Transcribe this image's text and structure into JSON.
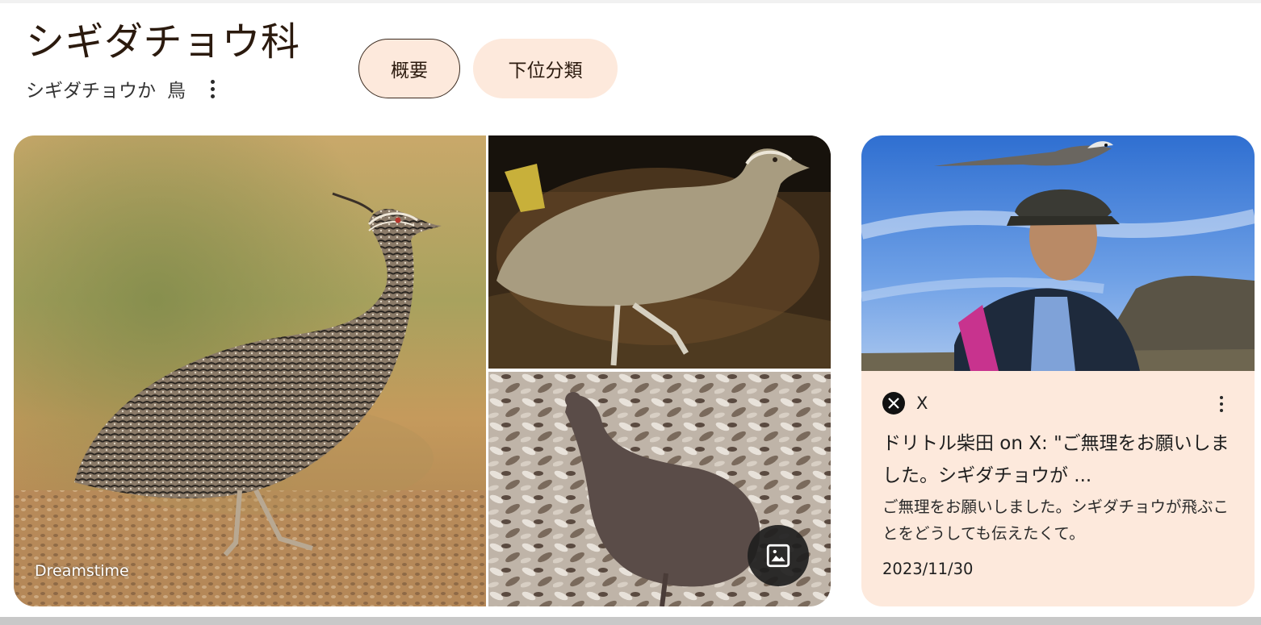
{
  "header": {
    "title": "シギダチョウ科",
    "subtitle_parts": [
      "シギダチョウか",
      "鳥"
    ],
    "more_icon": "more-vert-icon"
  },
  "chips": [
    {
      "label": "概要",
      "selected": true
    },
    {
      "label": "下位分類",
      "selected": false
    }
  ],
  "images": {
    "main_source_label": "Dreamstime",
    "more_images_icon": "image-icon"
  },
  "result_card": {
    "source_icon": "x-logo-icon",
    "source_name": "X",
    "title": "ドリトル柴田 on X: \"ご無理をお願いしました。シギダチョウが ...",
    "snippet": "ご無理をお願いしました。シギダチョウが飛ぶことをどうしても伝えたくて。",
    "date": "2023/11/30",
    "more_icon": "more-vert-icon"
  },
  "colors": {
    "chip_bg": "#fde9dc",
    "card_bg": "#fde9dc",
    "title_text": "#2b1a0e"
  }
}
